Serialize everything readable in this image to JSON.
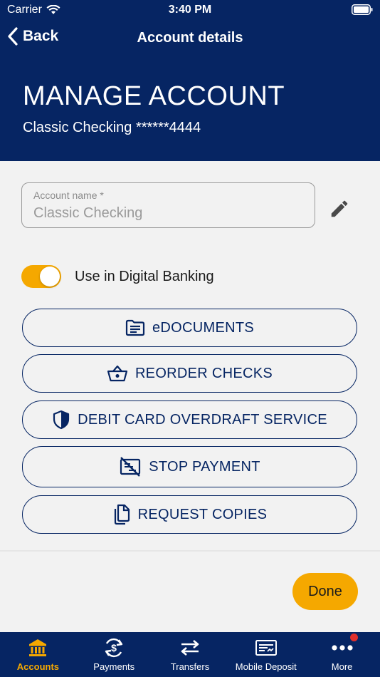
{
  "status_bar": {
    "carrier": "Carrier",
    "time": "3:40 PM"
  },
  "nav": {
    "back_label": "Back",
    "title": "Account details"
  },
  "header": {
    "title": "MANAGE ACCOUNT",
    "subtitle": "Classic Checking ******4444"
  },
  "account_name": {
    "label": "Account name *",
    "value": "Classic Checking"
  },
  "digital_banking": {
    "label": "Use in Digital Banking",
    "enabled": true
  },
  "actions": [
    {
      "label": "eDOCUMENTS",
      "icon": "folder-document-icon"
    },
    {
      "label": "REORDER CHECKS",
      "icon": "basket-icon"
    },
    {
      "label": "DEBIT CARD OVERDRAFT SERVICE",
      "icon": "shield-icon"
    },
    {
      "label": "STOP PAYMENT",
      "icon": "stop-check-icon"
    },
    {
      "label": "REQUEST COPIES",
      "icon": "copy-icon"
    }
  ],
  "done_label": "Done",
  "tabs": [
    {
      "label": "Accounts",
      "icon": "bank-icon",
      "active": true
    },
    {
      "label": "Payments",
      "icon": "payments-icon",
      "active": false
    },
    {
      "label": "Transfers",
      "icon": "transfer-arrows-icon",
      "active": false
    },
    {
      "label": "Mobile Deposit",
      "icon": "check-deposit-icon",
      "active": false
    },
    {
      "label": "More",
      "icon": "more-dots-icon",
      "active": false,
      "has_notification": true
    }
  ],
  "colors": {
    "brand_navy": "#062563",
    "accent_gold": "#f5a800",
    "notification_red": "#e0302c"
  }
}
